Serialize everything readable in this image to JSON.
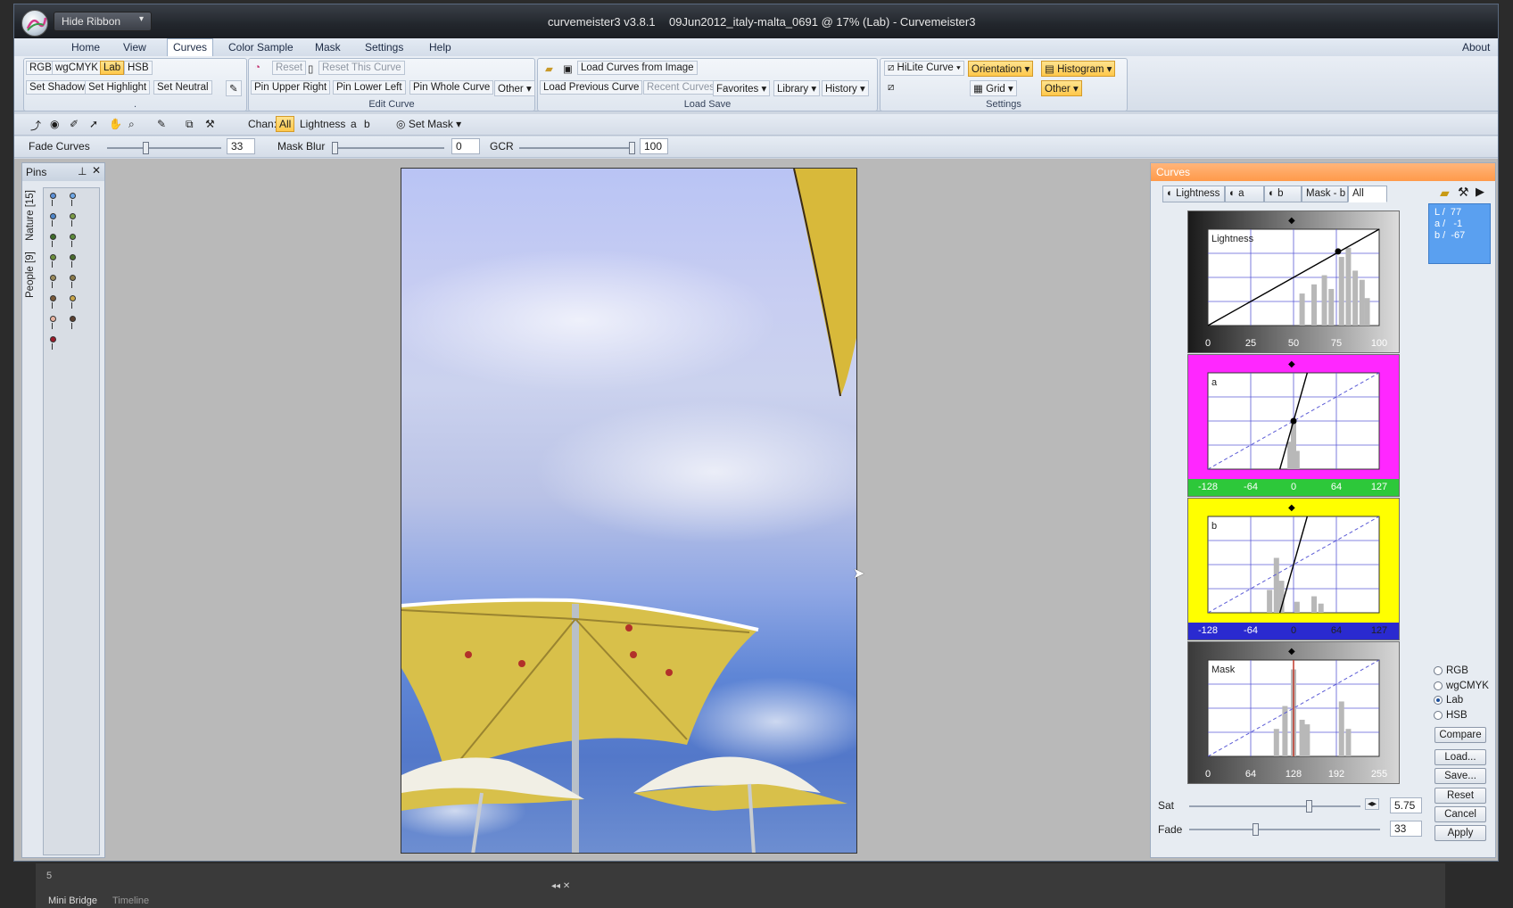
{
  "titlebar": {
    "hide_ribbon": "Hide Ribbon",
    "app_version": "curvemeister3 v3.8.1",
    "doc_title": "09Jun2012_italy-malta_0691 @ 17% (Lab) - Curvemeister3"
  },
  "menu": {
    "items": [
      "Home",
      "View",
      "Curves",
      "Color Sample",
      "Mask",
      "Settings",
      "Help"
    ],
    "about": "About"
  },
  "ribbon": {
    "group1": {
      "rgb": "RGB",
      "wgcmyk": "wgCMYK",
      "lab": "Lab",
      "hsb": "HSB",
      "set_shadow": "Set Shadow",
      "set_highlight": "Set Highlight",
      "set_neutral": "Set Neutral",
      "label": "."
    },
    "edit_curve": {
      "reset": "Reset",
      "reset_this": "Reset This Curve",
      "pin_ur": "Pin Upper Right",
      "pin_ll": "Pin Lower Left",
      "pin_whole": "Pin Whole Curve",
      "other": "Other",
      "label": "Edit Curve"
    },
    "load_save": {
      "load_from_image": "Load Curves from Image",
      "load_previous": "Load Previous Curve",
      "recent": "Recent Curves",
      "favorites": "Favorites",
      "library": "Library",
      "history": "History",
      "label": "Load Save"
    },
    "settings": {
      "hilite": "HiLite Curve",
      "orientation": "Orientation",
      "histogram": "Histogram",
      "grid": "Grid",
      "other": "Other",
      "label": "Settings"
    }
  },
  "toolbar": {
    "chan_label": "Chan:",
    "chan_all": "All",
    "chan_lightness": "Lightness",
    "chan_a": "a",
    "chan_b": "b",
    "set_mask": "Set Mask",
    "fade_curves": "Fade Curves",
    "fade_value": "33",
    "mask_blur": "Mask Blur",
    "mask_blur_value": "0",
    "gcr": "GCR",
    "gcr_value": "100"
  },
  "pins": {
    "title": "Pins",
    "tab_nature": "Nature [15]",
    "tab_people": "People [9]",
    "colors": [
      "#5b8fd6",
      "#6ea7e6",
      "#4f86c9",
      "#7a9a46",
      "#3e6b2a",
      "#5c8a3a",
      "#6b8e3c",
      "#4a6b2e",
      "#9a8a5a",
      "#8a7a4a",
      "#7a5a3a",
      "#c9a64a",
      "#e6b2a0",
      "#5a4030",
      "#9a1a2a"
    ]
  },
  "curves": {
    "title": "Curves",
    "tabs": [
      "Lightness",
      "a",
      "b",
      "Mask - b",
      "All"
    ],
    "readout": {
      "l": "L /  77",
      "a": "a /   -1",
      "b": "b /  -67"
    },
    "charts": [
      {
        "label": "Lightness",
        "ticks": [
          "0",
          "25",
          "50",
          "75",
          "100"
        ]
      },
      {
        "label": "a",
        "ticks": [
          "-128",
          "-64",
          "0",
          "64",
          "127"
        ]
      },
      {
        "label": "b",
        "ticks": [
          "-128",
          "-64",
          "0",
          "64",
          "127"
        ]
      },
      {
        "label": "Mask",
        "ticks": [
          "0",
          "64",
          "128",
          "192",
          "255"
        ]
      }
    ],
    "modes": [
      "RGB",
      "wgCMYK",
      "Lab",
      "HSB"
    ],
    "selected_mode": "Lab",
    "buttons": {
      "compare": "Compare",
      "load": "Load...",
      "save": "Save...",
      "reset": "Reset",
      "cancel": "Cancel",
      "apply": "Apply"
    },
    "sat_label": "Sat",
    "sat_value": "5.75",
    "sat_fraction": 0.68,
    "fade_label": "Fade",
    "fade_value": "33",
    "fade_fraction": 0.33
  },
  "bottom": {
    "panel_number": "5",
    "tab_mini_bridge": "Mini Bridge",
    "tab_timeline": "Timeline"
  }
}
